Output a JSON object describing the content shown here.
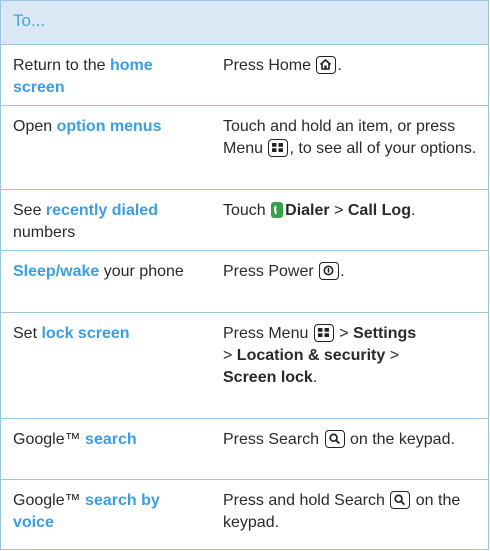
{
  "header": {
    "label": "To..."
  },
  "rows": [
    {
      "left": {
        "pre": "Return to the ",
        "highlight": "home screen"
      },
      "right": {
        "text": "Press Home",
        "post": "."
      }
    },
    {
      "left": {
        "pre": "Open ",
        "highlight": "option menus"
      },
      "right": {
        "pre": "Touch and hold an item, or press Menu",
        "post": ", to see all of your options."
      }
    },
    {
      "left": {
        "pre": "See ",
        "highlight": "recently dialed",
        "post": " numbers"
      },
      "right": {
        "pre": "Touch",
        "app": "Dialer",
        "sep": " > ",
        "item": "Call Log",
        "post": "."
      }
    },
    {
      "left": {
        "highlight": "Sleep/wake",
        "post": " your phone"
      },
      "right": {
        "text": "Press Power",
        "post": "."
      }
    },
    {
      "left": {
        "pre": "Set ",
        "highlight": "lock screen"
      },
      "right": {
        "pre": "Press Menu",
        "sep1": " > ",
        "item1": "Settings",
        "sep2": " > ",
        "item2": "Location & security",
        "sep3": " > ",
        "item3": "Screen lock",
        "post": "."
      }
    },
    {
      "left": {
        "pre": "Google™ ",
        "highlight": "search"
      },
      "right": {
        "pre": "Press Search",
        "post": " on the keypad."
      }
    },
    {
      "left": {
        "pre": "Google™ ",
        "highlight": "search by voice"
      },
      "right": {
        "pre": "Press and hold Search",
        "post": " on the keypad."
      }
    }
  ],
  "icons": {
    "home_key": "home-key-icon",
    "menu_key": "menu-key-icon",
    "dialer_app": "dialer-app-icon",
    "power_key": "power-key-icon",
    "search_key": "search-key-icon"
  },
  "colors": {
    "accent": "#3b9ee3",
    "header_bg": "#d9e8f3",
    "rule": "#9cc6e0",
    "dialer": "#36a04b"
  }
}
